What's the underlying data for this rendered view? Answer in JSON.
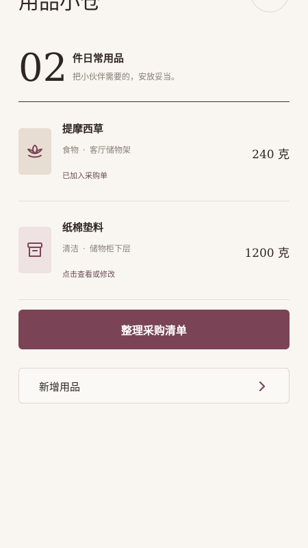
{
  "header": {
    "title": "用品小仓"
  },
  "summary": {
    "count": "02",
    "title": "件日常用品",
    "subtitle": "把小伙伴需要的，安放妥当。"
  },
  "items": [
    {
      "name": "提摩西草",
      "category": "食物",
      "separator": "·",
      "location": "客厅储物架",
      "status": "已加入采购单",
      "quantity": "240 克",
      "icon": "leaf-icon",
      "icon_bg": "#e8ddd2"
    },
    {
      "name": "纸棉垫料",
      "category": "清洁",
      "separator": "·",
      "location": "储物柜下层",
      "status": "点击查看或修改",
      "quantity": "1200 克",
      "icon": "archive-box-icon",
      "icon_bg": "#efe2e2"
    }
  ],
  "actions": {
    "primary_label": "整理采购清单",
    "secondary_label": "新增用品"
  },
  "colors": {
    "accent": "#7a4456",
    "background": "#f9f6f1",
    "text": "#2f2624"
  }
}
